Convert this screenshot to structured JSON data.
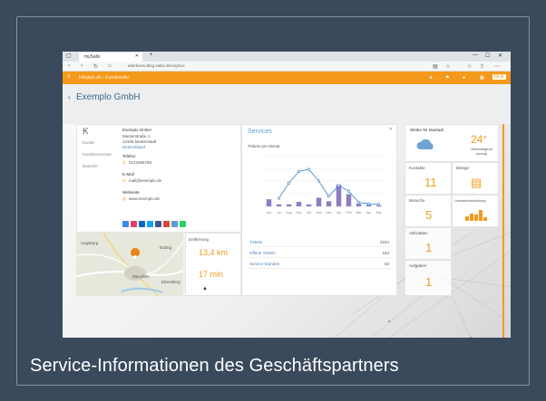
{
  "caption": "Service-Informationen des Geschäftspartners",
  "browser": {
    "tab_title": "mySalix",
    "url": "aiterkonsulting.salex.de/org/svc",
    "window_controls": [
      "—",
      "☐",
      "✕"
    ]
  },
  "toolbar": {
    "breadcrumb": "Infoplan.de › Kundenwiki",
    "right_icons": [
      "star-icon",
      "flag-icon",
      "bell-icon",
      "grid-icon",
      "user-icon"
    ],
    "user_badge": "MUE"
  },
  "page": {
    "title": "Exemplo GmbH",
    "back_icon": "chevron-left-icon"
  },
  "contact": {
    "avatar_letter": "K",
    "left_labels": [
      "Kunde",
      "Kundennummer",
      "Branche"
    ],
    "company": "Exemplo GmbH",
    "address": [
      "Musterstraße 1",
      "12345 Musterstadt",
      "Deutschland"
    ],
    "phone_label": "Telefon",
    "phone": "0123456789",
    "email_label": "E-Mail",
    "email": "mail@exemplo.de",
    "web_label": "Webseite",
    "web": "www.exemplo.de",
    "social_colors": [
      "#4285f4",
      "#e4405f",
      "#0a66c2",
      "#1da1f2",
      "#3b5998",
      "#db4437",
      "#5b9bd5",
      "#25d366"
    ]
  },
  "services": {
    "title": "Services",
    "subtitle": "Tickets pro Monat",
    "rows": [
      {
        "label": "Tickets",
        "value": "2244"
      },
      {
        "label": "Offene Tickets",
        "value": "164"
      },
      {
        "label": "Service-Stunden",
        "value": "53"
      }
    ]
  },
  "chart_data": {
    "type": "bar",
    "categories": [
      "Jun",
      "Jul",
      "Aug",
      "Sep",
      "Okt",
      "Nov",
      "Dez",
      "Jan",
      "Feb",
      "Mär",
      "Apr",
      "Mai"
    ],
    "series": [
      {
        "values": [
          14,
          4,
          4,
          9,
          4,
          17,
          10,
          43,
          24,
          5,
          3,
          2
        ]
      },
      {
        "values": [
          null,
          16,
          46,
          69,
          73,
          50,
          20,
          41,
          30,
          8,
          5,
          4
        ]
      }
    ],
    "ylim": [
      0,
      100
    ]
  },
  "map": {
    "labels": [
      "Augsburg",
      "Erding",
      "München",
      "Ebersberg"
    ],
    "distance_label": "Entfernung",
    "distance_value": "13,4 km",
    "time_value": "17 min"
  },
  "weather": {
    "title": "Wetter für Mustadt",
    "temp": "24°",
    "desc": "Überwiegend sonnig"
  },
  "stats": [
    {
      "label": "Kontakte",
      "value": "11"
    },
    {
      "label": "Belege",
      "value": ""
    },
    {
      "label": "Besuche",
      "value": "5"
    },
    {
      "label": "Umsatzentwicklung",
      "value": ""
    },
    {
      "label": "Aktivitäten",
      "value": "1"
    },
    {
      "label": "Aufgaben",
      "value": "1"
    }
  ],
  "colors": {
    "accent": "#f39a1c",
    "bar": "#8e7cc3",
    "line": "#3d85c6",
    "title": "#3d6a8f"
  }
}
